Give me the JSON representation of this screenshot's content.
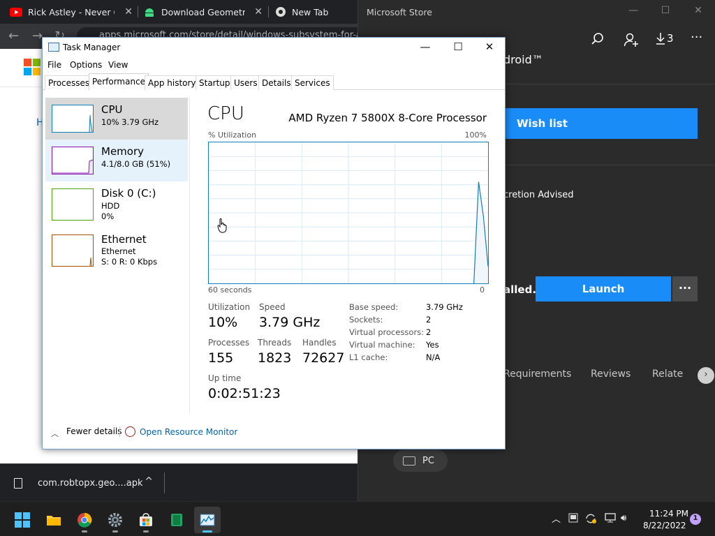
{
  "browser": {
    "tabs": [
      {
        "title": "Rick Astley - Never Gonna Give You Up",
        "icon": "youtube-icon"
      },
      {
        "title": "Download Geometry Dash",
        "icon": "android-icon"
      },
      {
        "title": "New Tab",
        "icon": "chrome-icon"
      }
    ],
    "url": "apps.microsoft.com/store/detail/windows-subsystem-for-an",
    "page_heading_fragment": "H",
    "download": {
      "filename": "com.robtopx.geo....apk"
    },
    "brand_colors": [
      "#f25022",
      "#7fba00",
      "#00a4ef",
      "#ffb900"
    ]
  },
  "store": {
    "title": "Microsoft Store",
    "download_count": "3",
    "app_name_fragment": "droid™",
    "wishlist_label": "Wish list",
    "rating_fragment": "cretion Advised",
    "installed_fragment": "alled.",
    "launch_label": "Launch",
    "more_label": "···",
    "tabs": [
      "Requirements",
      "Reviews",
      "Relate"
    ],
    "device_chip": "PC",
    "accent": "#1a8cf8"
  },
  "taskmanager": {
    "title": "Task Manager",
    "menu": [
      "File",
      "Options",
      "View"
    ],
    "tabs": [
      "Processes",
      "Performance",
      "App history",
      "Startup",
      "Users",
      "Details",
      "Services"
    ],
    "active_tab": "Performance",
    "resources": [
      {
        "name": "CPU",
        "line1": "10% 3.79 GHz",
        "line2": "",
        "color": "#117dbb"
      },
      {
        "name": "Memory",
        "line1": "4.1/8.0 GB (51%)",
        "line2": "",
        "color": "#8b12ae"
      },
      {
        "name": "Disk 0 (C:)",
        "line1": "HDD",
        "line2": "0%",
        "color": "#4da60c"
      },
      {
        "name": "Ethernet",
        "line1": "Ethernet",
        "line2": "S: 0 R: 0 Kbps",
        "color": "#a74f01"
      }
    ],
    "cpu": {
      "heading": "CPU",
      "model": "AMD Ryzen 7 5800X 8-Core Processor",
      "util_label": "% Utilization",
      "util_max": "100%",
      "time_left": "60 seconds",
      "time_right": "0",
      "stats": {
        "utilization_label": "Utilization",
        "utilization": "10%",
        "speed_label": "Speed",
        "speed": "3.79 GHz",
        "processes_label": "Processes",
        "processes": "155",
        "threads_label": "Threads",
        "threads": "1823",
        "handles_label": "Handles",
        "handles": "72627",
        "uptime_label": "Up time",
        "uptime": "0:02:51:23"
      },
      "info": [
        {
          "key": "Base speed:",
          "value": "3.79 GHz"
        },
        {
          "key": "Sockets:",
          "value": "2"
        },
        {
          "key": "Virtual processors:",
          "value": "2"
        },
        {
          "key": "Virtual machine:",
          "value": "Yes"
        },
        {
          "key": "L1 cache:",
          "value": "N/A"
        }
      ],
      "history_percent": [
        0,
        0,
        0,
        0,
        0,
        0,
        0,
        0,
        0,
        0,
        0,
        0,
        0,
        0,
        0,
        0,
        0,
        0,
        0,
        0,
        0,
        0,
        0,
        0,
        0,
        0,
        0,
        0,
        0,
        0,
        0,
        0,
        0,
        0,
        0,
        0,
        0,
        0,
        0,
        0,
        0,
        0,
        0,
        0,
        0,
        0,
        0,
        0,
        0,
        0,
        0,
        0,
        0,
        0,
        0,
        0,
        0,
        72,
        48,
        12
      ]
    },
    "footer": {
      "fewer_details": "Fewer details",
      "open_resource_monitor": "Open Resource Monitor"
    }
  },
  "taskbar": {
    "apps": [
      "start-icon",
      "file-explorer-icon",
      "chrome-icon",
      "settings-icon",
      "store-icon",
      "bluestacks-icon",
      "task-manager-icon"
    ],
    "time": "11:24 PM",
    "date": "8/22/2022",
    "notifications": "1"
  }
}
